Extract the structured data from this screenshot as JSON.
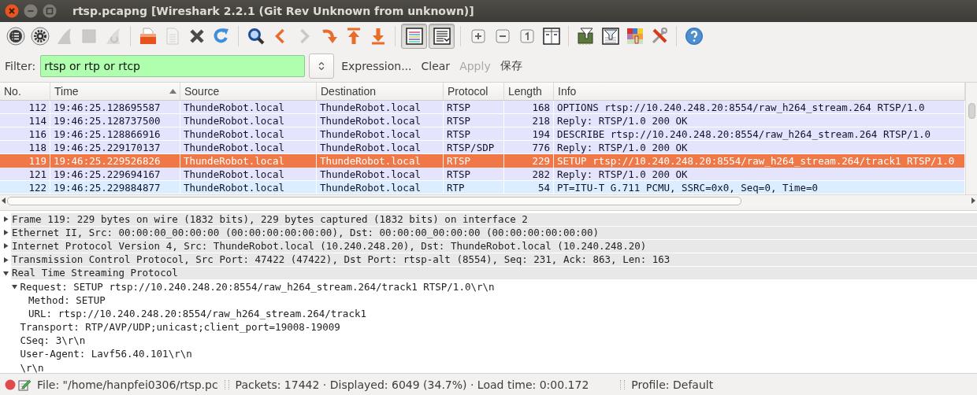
{
  "window": {
    "title": "rtsp.pcapng [Wireshark 2.2.1 (Git Rev Unknown from unknown)]"
  },
  "toolbar": [
    {
      "kind": "interfaces",
      "disabled": false,
      "pressed": false
    },
    {
      "kind": "options",
      "disabled": false,
      "pressed": false
    },
    {
      "kind": "start",
      "disabled": true,
      "pressed": false
    },
    {
      "kind": "stop",
      "disabled": true,
      "pressed": false
    },
    {
      "kind": "restart",
      "disabled": true,
      "pressed": false
    },
    {
      "kind": "separator"
    },
    {
      "kind": "open",
      "disabled": false,
      "pressed": false
    },
    {
      "kind": "save",
      "disabled": true,
      "pressed": false
    },
    {
      "kind": "close",
      "disabled": false,
      "pressed": false
    },
    {
      "kind": "reload",
      "disabled": false,
      "pressed": false
    },
    {
      "kind": "separator"
    },
    {
      "kind": "find",
      "disabled": false,
      "pressed": false
    },
    {
      "kind": "back",
      "disabled": false,
      "pressed": false
    },
    {
      "kind": "forward",
      "disabled": true,
      "pressed": false
    },
    {
      "kind": "goto",
      "disabled": false,
      "pressed": false
    },
    {
      "kind": "first",
      "disabled": false,
      "pressed": false
    },
    {
      "kind": "last",
      "disabled": false,
      "pressed": false
    },
    {
      "kind": "separator"
    },
    {
      "kind": "colorize",
      "disabled": false,
      "pressed": true
    },
    {
      "kind": "autoscroll",
      "disabled": false,
      "pressed": true
    },
    {
      "kind": "separator"
    },
    {
      "kind": "zoom-in",
      "disabled": false,
      "pressed": false
    },
    {
      "kind": "zoom-out",
      "disabled": false,
      "pressed": false
    },
    {
      "kind": "normal-size",
      "disabled": false,
      "pressed": false
    },
    {
      "kind": "resize-columns",
      "disabled": false,
      "pressed": false
    },
    {
      "kind": "separator"
    },
    {
      "kind": "capture-filters",
      "disabled": false,
      "pressed": false
    },
    {
      "kind": "display-filters",
      "disabled": false,
      "pressed": false
    },
    {
      "kind": "coloring-rules",
      "disabled": false,
      "pressed": false
    },
    {
      "kind": "preferences",
      "disabled": false,
      "pressed": false
    },
    {
      "kind": "separator"
    },
    {
      "kind": "help",
      "disabled": false,
      "pressed": false
    }
  ],
  "filter": {
    "label": "Filter:",
    "value": "rtsp or rtp or rtcp",
    "buttons": [
      {
        "label": "Expression...",
        "disabled": false
      },
      {
        "label": "Clear",
        "disabled": false
      },
      {
        "label": "Apply",
        "disabled": true
      },
      {
        "label": "保存",
        "disabled": false
      }
    ]
  },
  "packets": {
    "columns": [
      {
        "label": "No.",
        "sorted": false
      },
      {
        "label": "Time",
        "sorted": true
      },
      {
        "label": "Source",
        "sorted": false
      },
      {
        "label": "Destination",
        "sorted": false
      },
      {
        "label": "Protocol",
        "sorted": false
      },
      {
        "label": "Length",
        "sorted": false
      },
      {
        "label": "Info",
        "sorted": false
      }
    ],
    "rows": [
      {
        "no": "112",
        "time": "19:46:25.128695587",
        "source": "ThundeRobot.local",
        "destination": "ThundeRobot.local",
        "protocol": "RTSP",
        "length": "168",
        "info": "OPTIONS rtsp://10.240.248.20:8554/raw_h264_stream.264 RTSP/1.0",
        "selected": false,
        "color": "#e4e4fc"
      },
      {
        "no": "114",
        "time": "19:46:25.128737500",
        "source": "ThundeRobot.local",
        "destination": "ThundeRobot.local",
        "protocol": "RTSP",
        "length": "218",
        "info": "Reply: RTSP/1.0 200 OK",
        "selected": false,
        "color": "#e4e4fc"
      },
      {
        "no": "116",
        "time": "19:46:25.128866916",
        "source": "ThundeRobot.local",
        "destination": "ThundeRobot.local",
        "protocol": "RTSP",
        "length": "194",
        "info": "DESCRIBE rtsp://10.240.248.20:8554/raw_h264_stream.264 RTSP/1.0",
        "selected": false,
        "color": "#e4e4fc"
      },
      {
        "no": "118",
        "time": "19:46:25.229170137",
        "source": "ThundeRobot.local",
        "destination": "ThundeRobot.local",
        "protocol": "RTSP/SDP",
        "length": "776",
        "info": "Reply: RTSP/1.0 200 OK",
        "selected": false,
        "color": "#e4e4fc"
      },
      {
        "no": "119",
        "time": "19:46:25.229526826",
        "source": "ThundeRobot.local",
        "destination": "ThundeRobot.local",
        "protocol": "RTSP",
        "length": "229",
        "info": "SETUP rtsp://10.240.248.20:8554/raw_h264_stream.264/track1 RTSP/1.0",
        "selected": true
      },
      {
        "no": "121",
        "time": "19:46:25.229694167",
        "source": "ThundeRobot.local",
        "destination": "ThundeRobot.local",
        "protocol": "RTSP",
        "length": "282",
        "info": "Reply: RTSP/1.0 200 OK",
        "selected": false,
        "color": "#e4e4fc"
      },
      {
        "no": "122",
        "time": "19:46:25.229884877",
        "source": "ThundeRobot.local",
        "destination": "ThundeRobot.local",
        "protocol": "RTP",
        "length": "54",
        "info": "PT=ITU-T G.711 PCMU, SSRC=0x0, Seq=0, Time=0",
        "selected": false,
        "color": "#daeeff"
      }
    ]
  },
  "details": [
    {
      "text": "Frame 119: 229 bytes on wire (1832 bits), 229 bytes captured (1832 bits) on interface 2",
      "expanded": false
    },
    {
      "text": "Ethernet II, Src: 00:00:00_00:00:00 (00:00:00:00:00:00), Dst: 00:00:00_00:00:00 (00:00:00:00:00:00)",
      "expanded": false
    },
    {
      "text": "Internet Protocol Version 4, Src: ThundeRobot.local (10.240.248.20), Dst: ThundeRobot.local (10.240.248.20)",
      "expanded": false
    },
    {
      "text": "Transmission Control Protocol, Src Port: 47422 (47422), Dst Port: rtsp-alt (8554), Seq: 231, Ack: 863, Len: 163",
      "expanded": false
    },
    {
      "text": "Real Time Streaming Protocol",
      "expanded": true,
      "children": [
        {
          "text": "Request: SETUP rtsp://10.240.248.20:8554/raw_h264_stream.264/track1 RTSP/1.0\\r\\n",
          "expanded": true,
          "children": [
            {
              "text": "Method: SETUP"
            },
            {
              "text": "URL: rtsp://10.240.248.20:8554/raw_h264_stream.264/track1"
            }
          ]
        },
        {
          "text": "Transport: RTP/AVP/UDP;unicast;client_port=19008-19009"
        },
        {
          "text": "CSeq: 3\\r\\n"
        },
        {
          "text": "User-Agent: Lavf56.40.101\\r\\n"
        },
        {
          "text": "\\r\\n"
        }
      ]
    }
  ],
  "status_bar": {
    "file": "File: \"/home/hanpfei0306/rtsp.pc",
    "counts": "Packets: 17442 · Displayed: 6049 (34.7%) · Load time: 0:00.172",
    "profile": "Profile: Default"
  }
}
